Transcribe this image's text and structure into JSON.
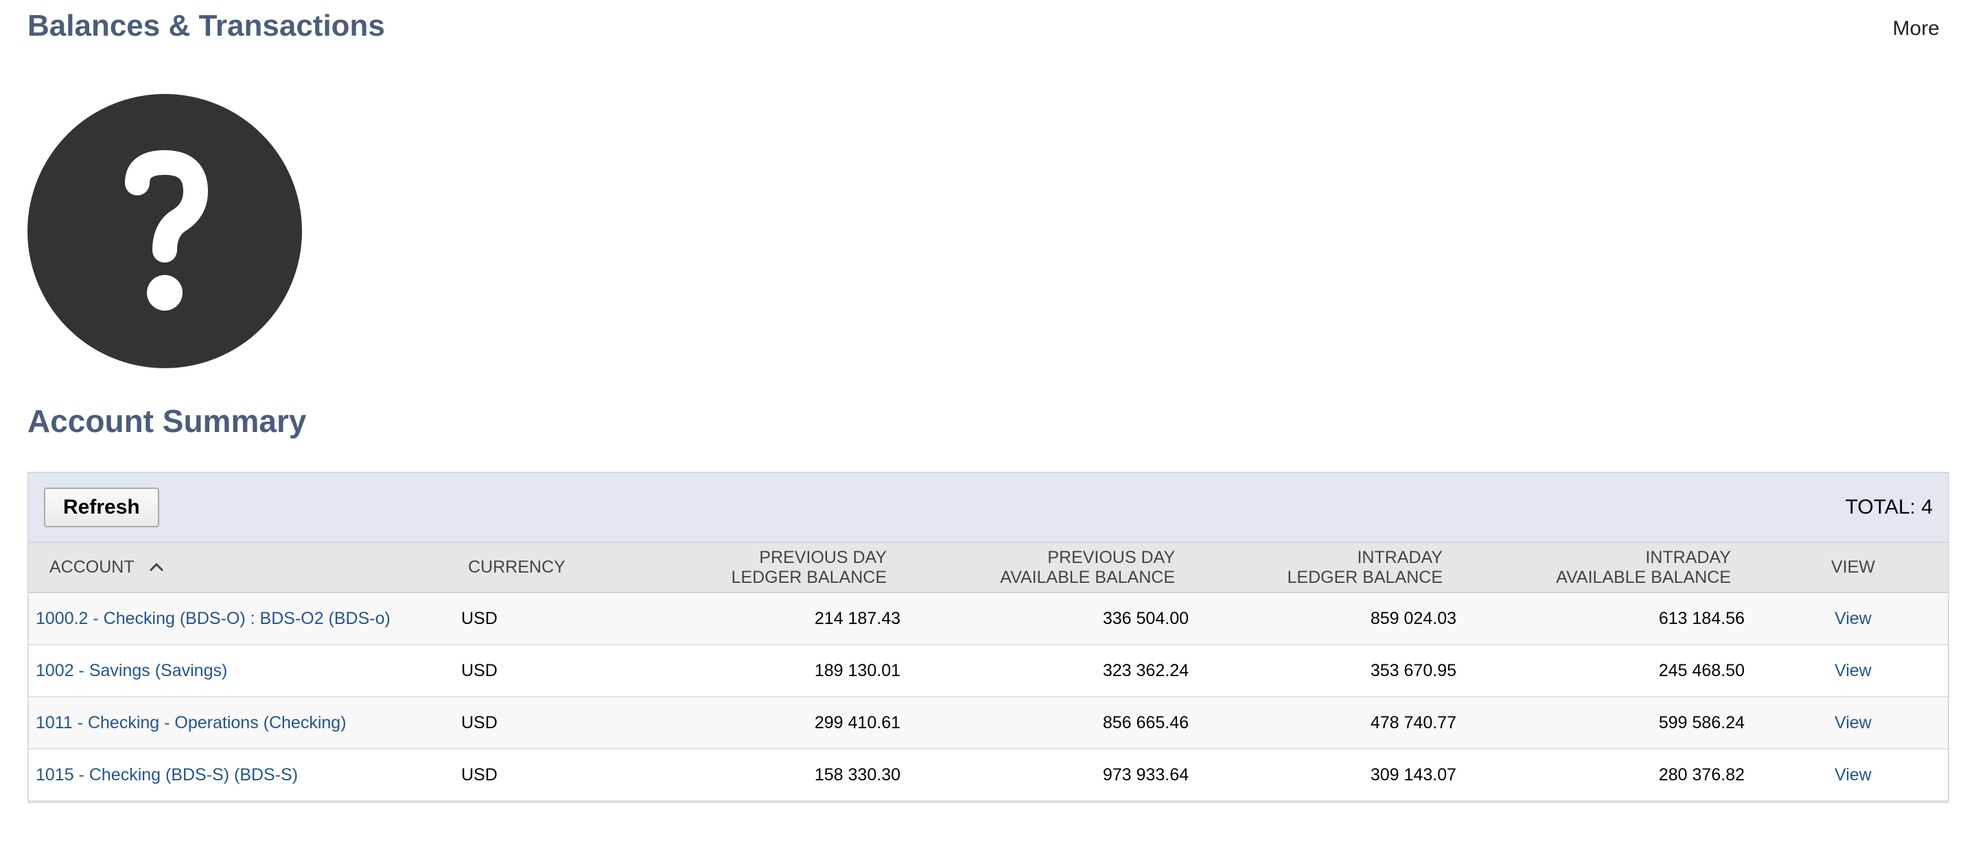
{
  "header": {
    "title": "Balances & Transactions",
    "more_label": "More"
  },
  "avatar": {
    "icon": "question-mark-icon"
  },
  "summary": {
    "title": "Account Summary",
    "refresh_label": "Refresh",
    "total_label": "TOTAL: 4",
    "columns": {
      "account": "ACCOUNT",
      "currency": "CURRENCY",
      "prev_ledger_line1": "PREVIOUS DAY",
      "prev_ledger_line2": "LEDGER BALANCE",
      "prev_avail_line1": "PREVIOUS DAY",
      "prev_avail_line2": "AVAILABLE BALANCE",
      "intra_ledger_line1": "INTRADAY",
      "intra_ledger_line2": "LEDGER BALANCE",
      "intra_avail_line1": "INTRADAY",
      "intra_avail_line2": "AVAILABLE BALANCE",
      "view": "VIEW"
    },
    "sort": {
      "column": "account",
      "direction": "ascending"
    },
    "rows": [
      {
        "account": "1000.2 - Checking (BDS-O) : BDS-O2 (BDS-o)",
        "currency": "USD",
        "prev_ledger": "214 187.43",
        "prev_avail": "336 504.00",
        "intra_ledger": "859 024.03",
        "intra_avail": "613 184.56",
        "view": "View"
      },
      {
        "account": "1002 - Savings (Savings)",
        "currency": "USD",
        "prev_ledger": "189 130.01",
        "prev_avail": "323 362.24",
        "intra_ledger": "353 670.95",
        "intra_avail": "245 468.50",
        "view": "View"
      },
      {
        "account": "1011 - Checking - Operations (Checking)",
        "currency": "USD",
        "prev_ledger": "299 410.61",
        "prev_avail": "856 665.46",
        "intra_ledger": "478 740.77",
        "intra_avail": "599 586.24",
        "view": "View"
      },
      {
        "account": "1015 - Checking (BDS-S) (BDS-S)",
        "currency": "USD",
        "prev_ledger": "158 330.30",
        "prev_avail": "973 933.64",
        "intra_ledger": "309 143.07",
        "intra_avail": "280 376.82",
        "view": "View"
      }
    ]
  },
  "colors": {
    "heading": "#4c5d79",
    "link": "#24558f",
    "toolbar_bg": "#e3e8f0",
    "header_bg": "#e6e6e6",
    "avatar_bg": "#333333"
  }
}
